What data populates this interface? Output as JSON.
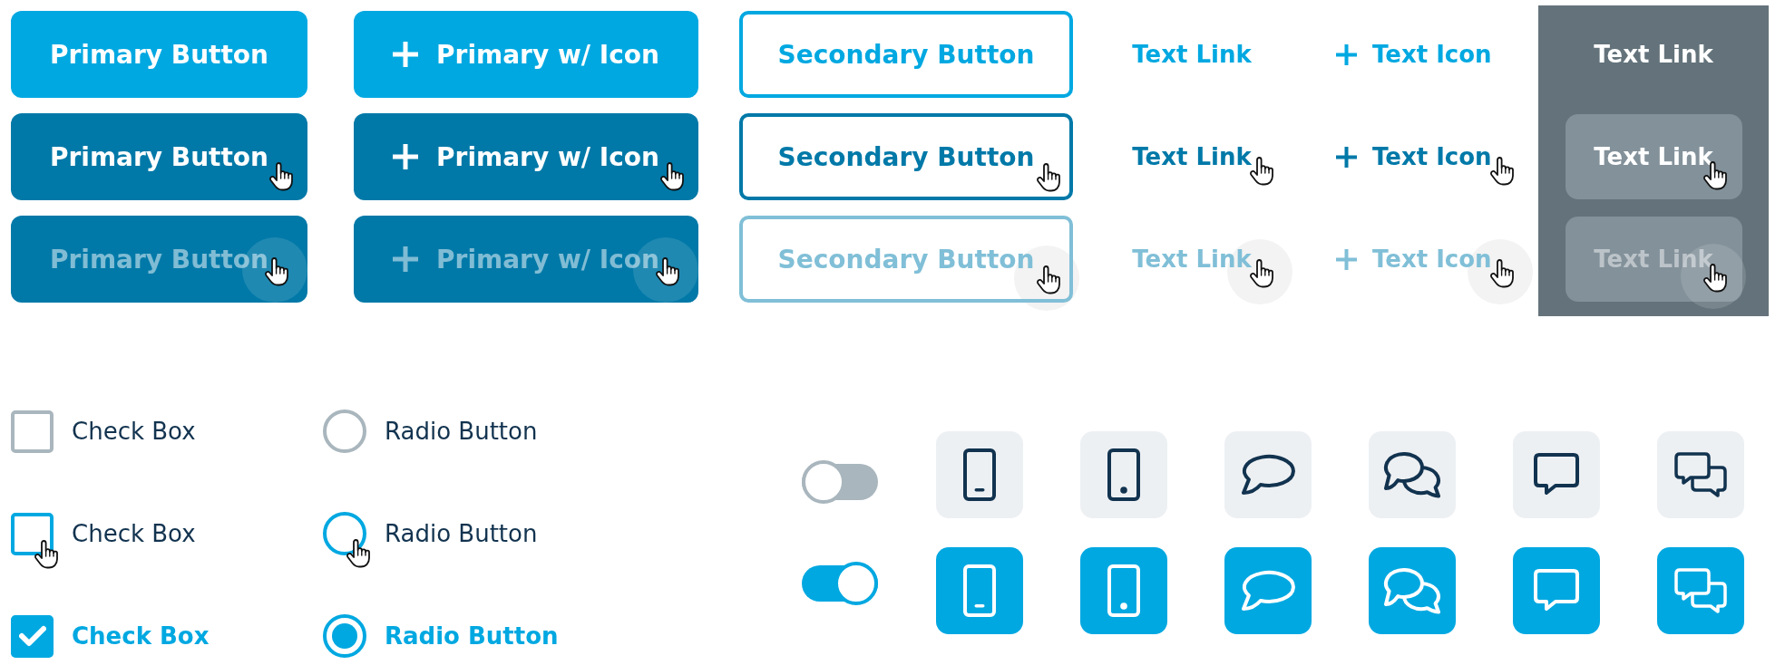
{
  "button_columns": [
    {
      "kind": "primary",
      "items": [
        {
          "label": "Primary Button",
          "hovered": false,
          "pressed": false
        },
        {
          "label": "Primary Button",
          "hovered": true,
          "pressed": false
        },
        {
          "label": "Primary Button",
          "hovered": true,
          "pressed": true
        }
      ]
    },
    {
      "kind": "primary-icon",
      "items": [
        {
          "label": "Primary w/ Icon",
          "hovered": false,
          "pressed": false
        },
        {
          "label": "Primary w/ Icon",
          "hovered": true,
          "pressed": false
        },
        {
          "label": "Primary w/ Icon",
          "hovered": true,
          "pressed": true
        }
      ]
    },
    {
      "kind": "secondary",
      "items": [
        {
          "label": "Secondary Button",
          "hovered": false,
          "pressed": false
        },
        {
          "label": "Secondary Button",
          "hovered": true,
          "pressed": false
        },
        {
          "label": "Secondary Button",
          "hovered": true,
          "pressed": true
        }
      ]
    },
    {
      "kind": "link",
      "items": [
        {
          "label": "Text Link",
          "hovered": false,
          "pressed": false
        },
        {
          "label": "Text Link",
          "hovered": true,
          "pressed": false
        },
        {
          "label": "Text Link",
          "hovered": true,
          "pressed": true
        }
      ]
    },
    {
      "kind": "link-icon",
      "items": [
        {
          "label": "Text Icon",
          "hovered": false,
          "pressed": false
        },
        {
          "label": "Text Icon",
          "hovered": true,
          "pressed": false
        },
        {
          "label": "Text Icon",
          "hovered": true,
          "pressed": true
        }
      ]
    },
    {
      "kind": "link-dark",
      "items": [
        {
          "label": "Text Link",
          "hovered": false,
          "pressed": false
        },
        {
          "label": "Text Link",
          "hovered": true,
          "pressed": false
        },
        {
          "label": "Text Link",
          "hovered": true,
          "pressed": true
        }
      ]
    }
  ],
  "checkboxes": [
    {
      "label": "Check Box",
      "checked": false,
      "hovered": false
    },
    {
      "label": "Check Box",
      "checked": false,
      "hovered": true
    },
    {
      "label": "Check Box",
      "checked": true,
      "hovered": false
    }
  ],
  "radios": [
    {
      "label": "Radio Button",
      "selected": false,
      "hovered": false
    },
    {
      "label": "Radio Button",
      "selected": false,
      "hovered": true
    },
    {
      "label": "Radio Button",
      "selected": true,
      "hovered": false
    }
  ],
  "toggles": [
    {
      "on": false
    },
    {
      "on": true
    }
  ],
  "tile_rows": [
    {
      "tiles": [
        {
          "kind": "phone-bar",
          "selected": false
        },
        {
          "kind": "phone-dot",
          "selected": false
        },
        {
          "kind": "bubble-oval",
          "selected": false
        },
        {
          "kind": "bubbles-oval",
          "selected": false
        },
        {
          "kind": "bubble-square",
          "selected": false
        },
        {
          "kind": "bubbles-square",
          "selected": false
        }
      ]
    },
    {
      "tiles": [
        {
          "kind": "phone-bar",
          "selected": true
        },
        {
          "kind": "phone-dot",
          "selected": true
        },
        {
          "kind": "bubble-oval",
          "selected": true
        },
        {
          "kind": "bubbles-oval",
          "selected": true
        },
        {
          "kind": "bubble-square",
          "selected": true
        },
        {
          "kind": "bubbles-square",
          "selected": true
        }
      ]
    }
  ]
}
